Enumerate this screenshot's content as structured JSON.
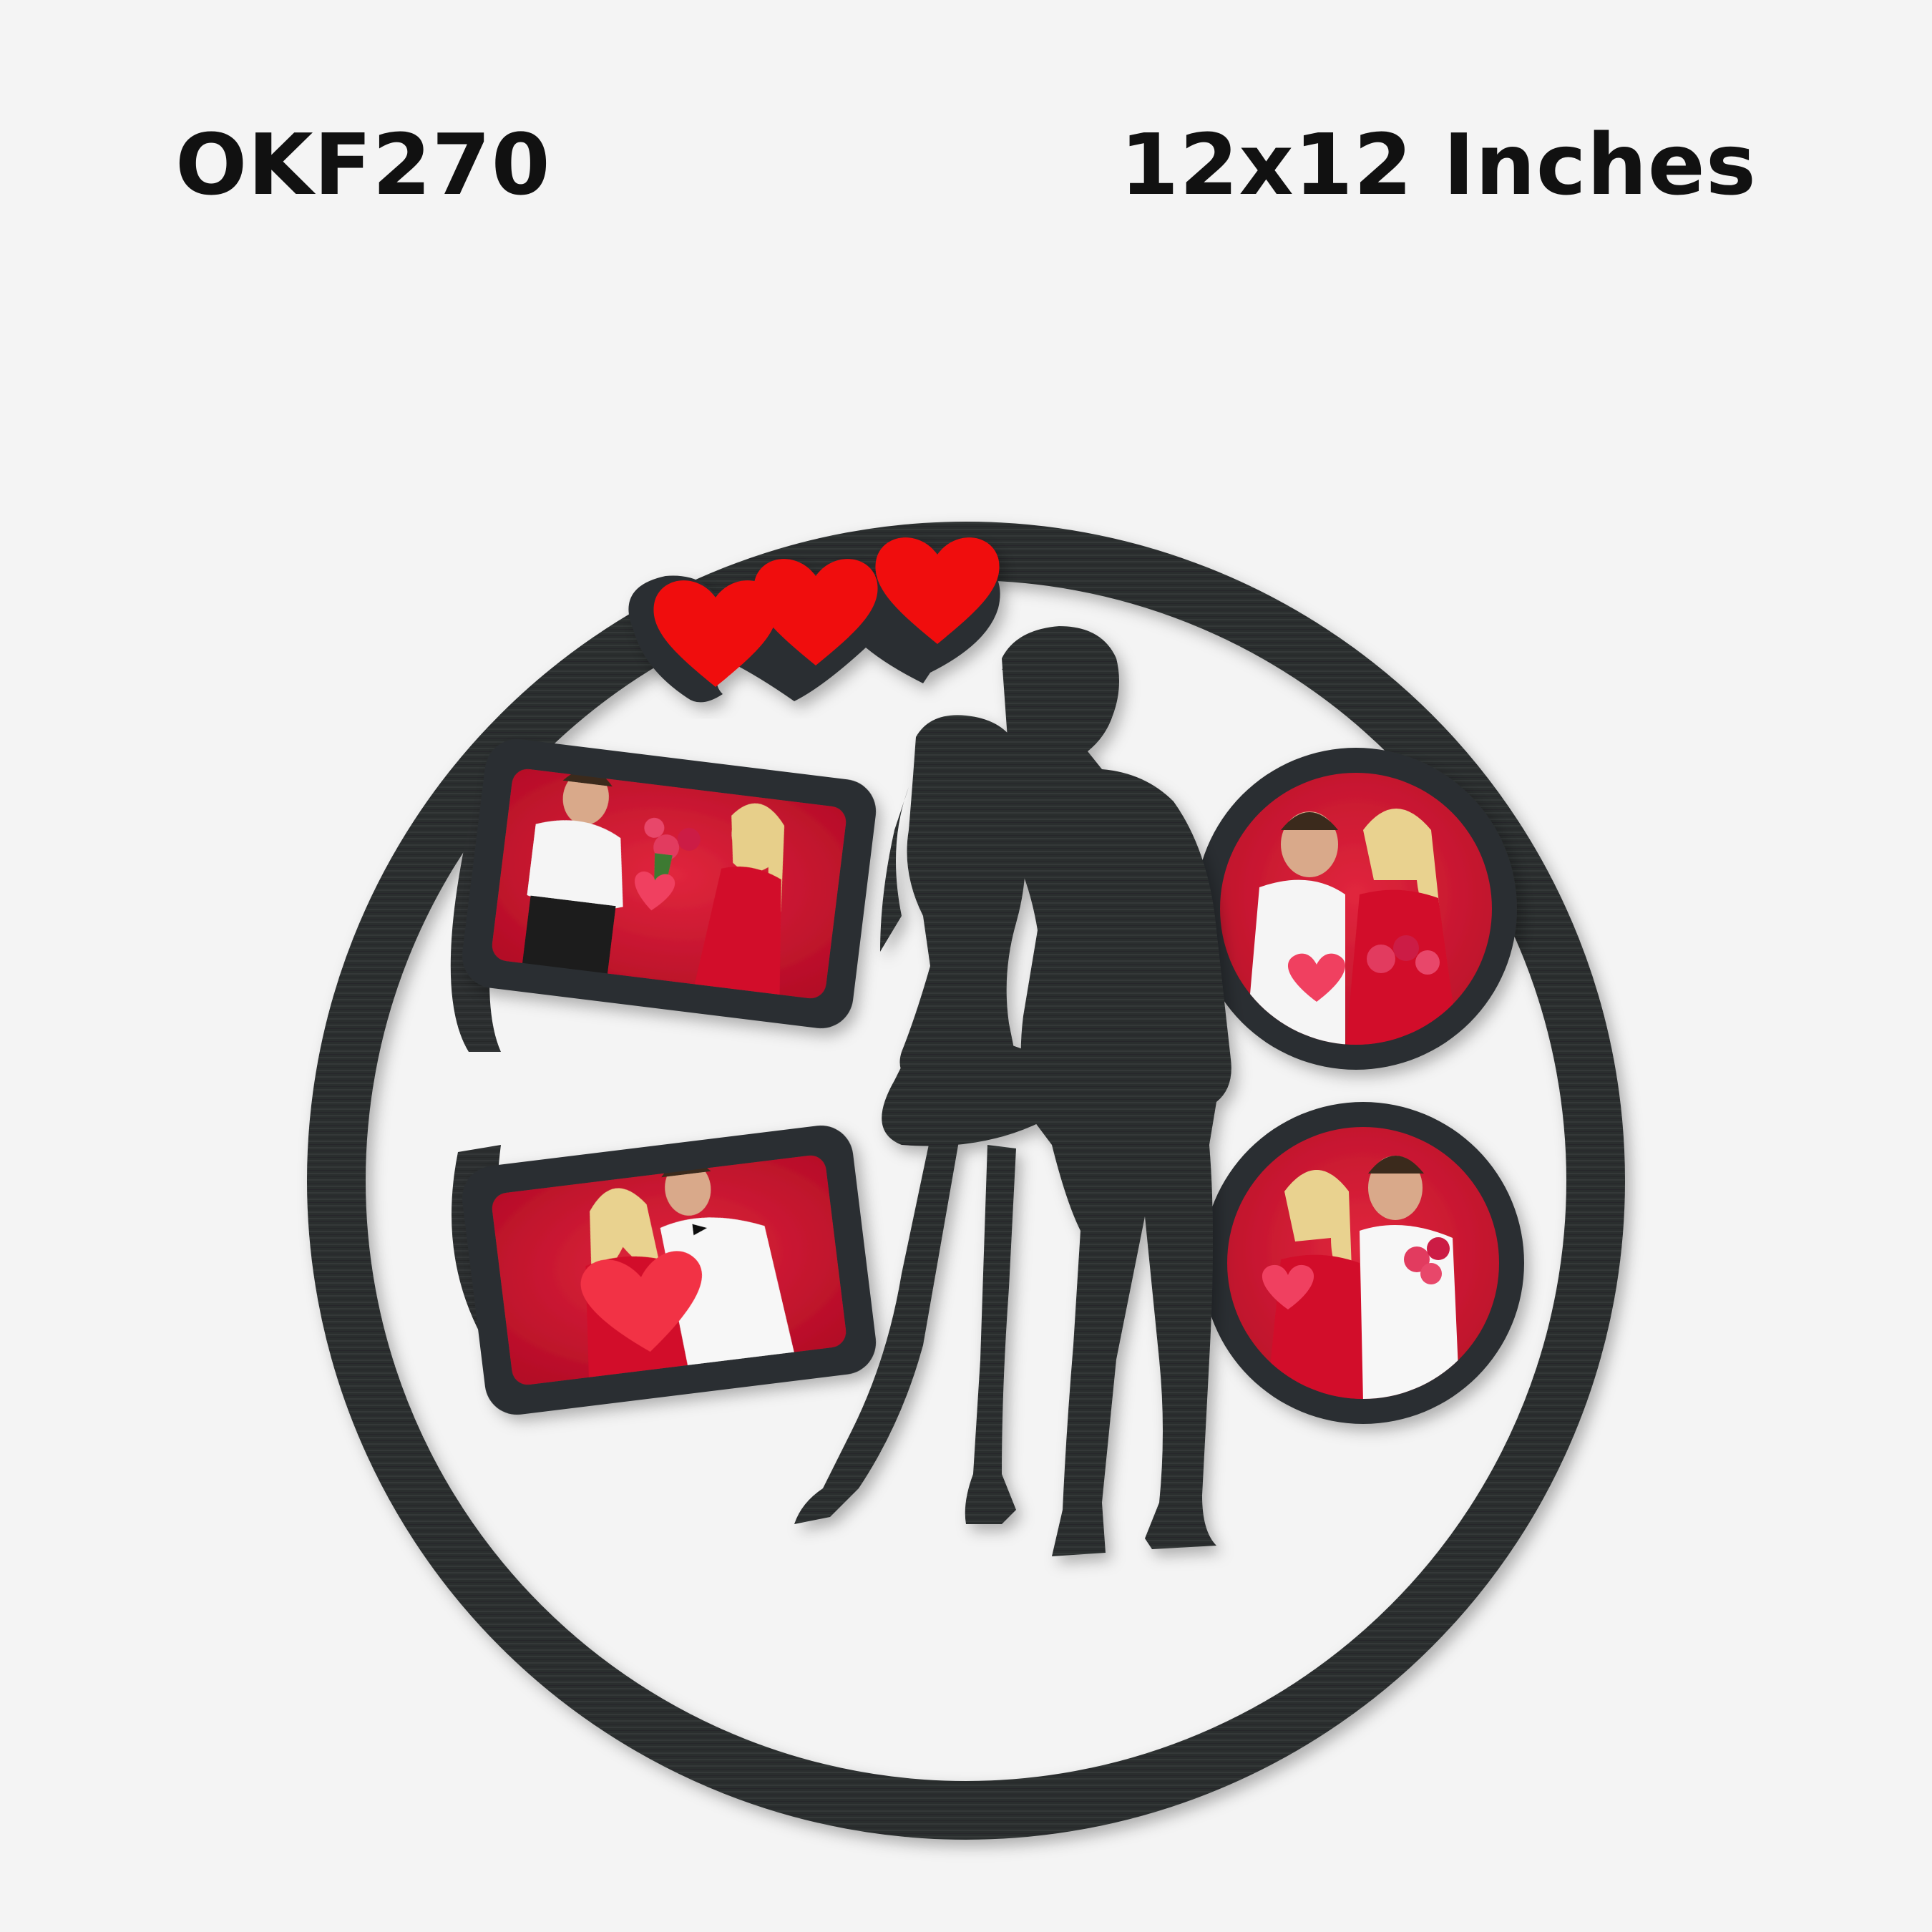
{
  "product": {
    "code": "OKF270",
    "size": "12x12 Inches"
  },
  "colors": {
    "background": "#f4f4f4",
    "frame_wood": "#2c2f30",
    "heart_red": "#f01010",
    "photo_red": "#c8102e",
    "text": "#111111"
  },
  "icons": [
    "heart-icon",
    "heart-icon",
    "heart-icon",
    "couple-silhouette"
  ]
}
